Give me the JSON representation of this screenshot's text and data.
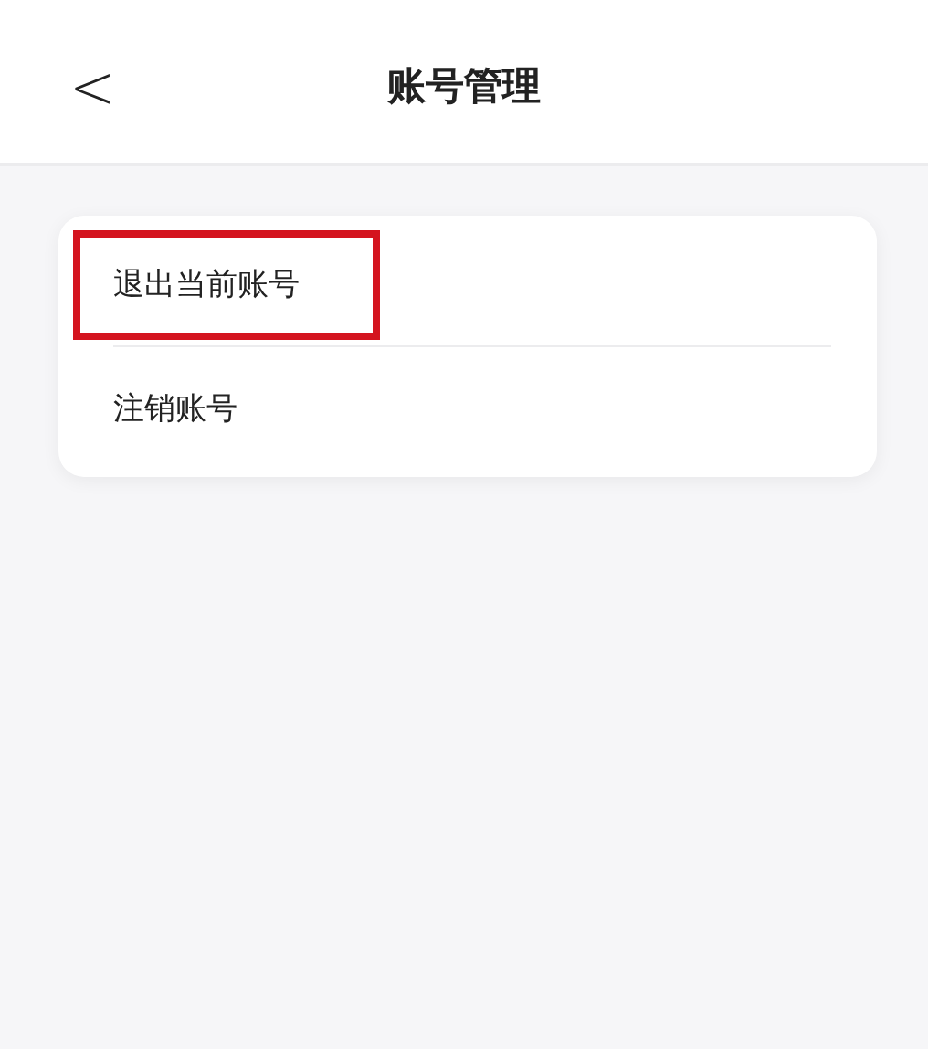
{
  "header": {
    "back": "<",
    "title": "账号管理"
  },
  "menu": {
    "items": [
      {
        "label": "退出当前账号",
        "highlighted": true
      },
      {
        "label": "注销账号",
        "highlighted": false
      }
    ]
  }
}
